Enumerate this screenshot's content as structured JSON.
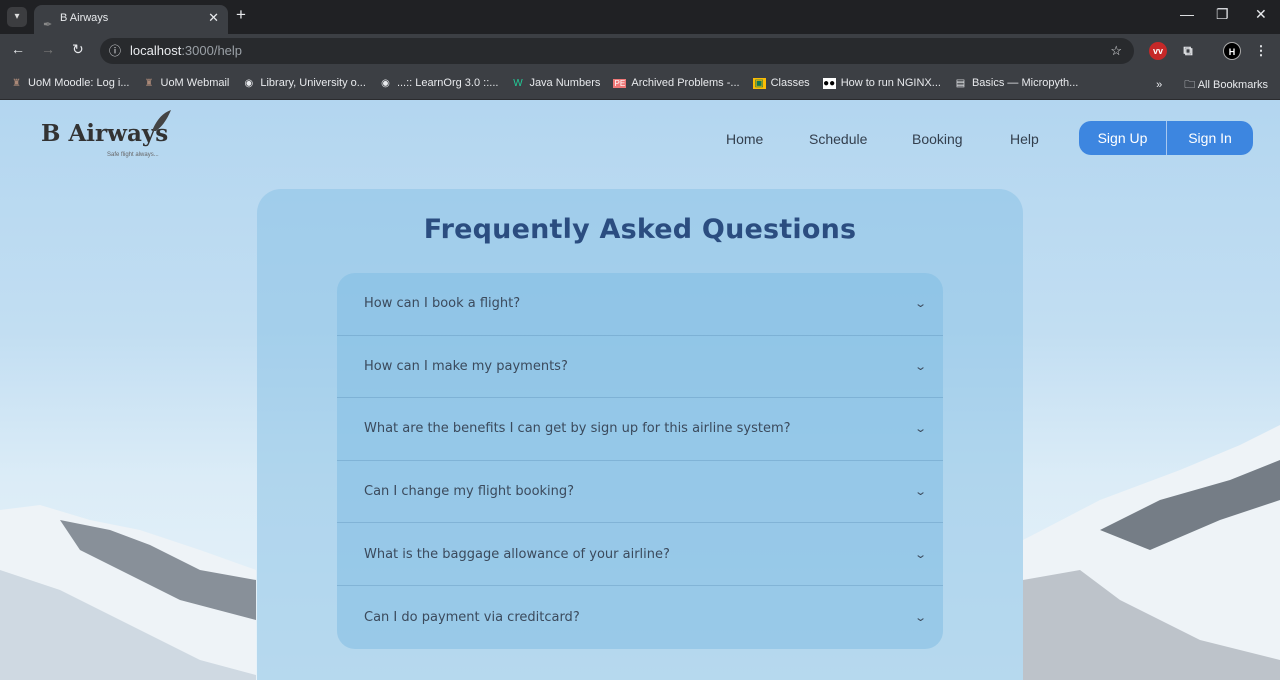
{
  "browser": {
    "tab_title": "B Airways",
    "url_host": "localhost",
    "url_path": ":3000/help",
    "bookmarks": [
      {
        "label": "UoM Moodle: Log i...",
        "icon": "crest-icon"
      },
      {
        "label": "UoM Webmail",
        "icon": "crest-icon"
      },
      {
        "label": "Library, University o...",
        "icon": "globe-icon"
      },
      {
        "label": "...:: LearnOrg 3.0 ::...",
        "icon": "globe-icon"
      },
      {
        "label": "Java Numbers",
        "icon": "w-icon"
      },
      {
        "label": "Archived Problems -...",
        "icon": "pe-icon"
      },
      {
        "label": "Classes",
        "icon": "classroom-icon"
      },
      {
        "label": "How to run NGINX...",
        "icon": "medium-icon"
      },
      {
        "label": "Basics — Micropyth...",
        "icon": "doc-icon"
      }
    ],
    "all_bookmarks": "All Bookmarks"
  },
  "site": {
    "logo": "B Airways",
    "tagline": "Safe flight always...",
    "nav": [
      "Home",
      "Schedule",
      "Booking",
      "Help"
    ],
    "sign_up": "Sign Up",
    "sign_in": "Sign In",
    "faq_title": "Frequently Asked Questions",
    "faqs": [
      "How can I book a flight?",
      "How can I make my payments?",
      "What are the benefits I can get by sign up for this airline system?",
      "Can I change my flight booking?",
      "What is the baggage allowance of your airline?",
      "Can I do payment via creditcard?"
    ],
    "accent": "#3d86e0"
  }
}
